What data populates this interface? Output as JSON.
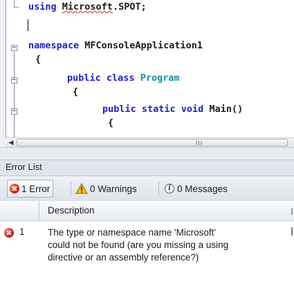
{
  "editor": {
    "lines": [
      {
        "pre": "",
        "kw": "using",
        "post_sq": "Microsoft",
        "rest": ".SPOT;"
      },
      {
        "kw": "namespace",
        "rest": " MFConsoleApplication1"
      },
      {
        "text": "{"
      },
      {
        "kw": "public class",
        "type": "Program"
      },
      {
        "text": "{"
      },
      {
        "kw": "public static void",
        "rest": " Main()"
      },
      {
        "text": "{"
      }
    ],
    "scroll_grip": "III"
  },
  "error_list": {
    "title": "Error List",
    "filters": {
      "errors": "1 Error",
      "warnings": "0 Warnings",
      "messages": "0 Messages"
    },
    "columns": {
      "description": "Description"
    },
    "rows": [
      {
        "number": "1",
        "description_lines": [
          "The type or namespace name 'Microsoft'",
          "could not be found (are you missing a using",
          "directive or an assembly reference?)"
        ]
      }
    ]
  },
  "colors": {
    "keyword": "#2020c8",
    "type": "#1e8fa0",
    "error": "#d22012",
    "warning": "#f2c200"
  },
  "icons": [
    "error-icon",
    "warning-icon",
    "info-icon",
    "collapse-icon",
    "scroll-left-icon"
  ]
}
